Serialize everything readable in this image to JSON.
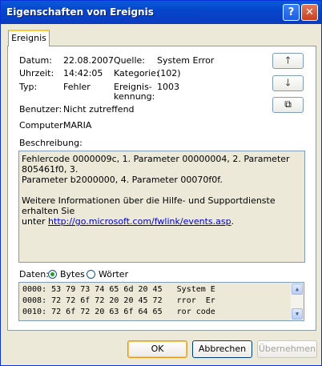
{
  "window": {
    "title": "Eigenschaften von Ereignis",
    "help_glyph": "?",
    "close_glyph": "✕"
  },
  "tab": {
    "label": "Ereignis"
  },
  "fields": {
    "datum_label": "Datum:",
    "datum_value": "22.08.2007",
    "uhrzeit_label": "Uhrzeit:",
    "uhrzeit_value": "14:42:05",
    "typ_label": "Typ:",
    "typ_value": "Fehler",
    "benutzer_label": "Benutzer:",
    "benutzer_value": "Nicht zutreffend",
    "computer_label": "Computer:",
    "computer_value": "MARIA",
    "quelle_label": "Quelle:",
    "quelle_value": "System Error",
    "kategorie_label": "Kategorie:",
    "kategorie_value": "(102)",
    "kennung_label_1": "Ereignis-",
    "kennung_label_2": "kennung:",
    "kennung_value": "1003"
  },
  "side_buttons": {
    "up": "🡑",
    "down": "🡓",
    "copy": "⧉"
  },
  "description": {
    "label": "Beschreibung:",
    "line1": "Fehlercode 0000009c, 1. Parameter 00000004, 2. Parameter 805461f0, 3.",
    "line2": "Parameter b2000000, 4. Parameter 00070f0f.",
    "line3": "Weitere Informationen über die Hilfe- und Supportdienste erhalten Sie",
    "line4_prefix": "unter ",
    "link": "http://go.microsoft.com/fwlink/events.asp",
    "line4_suffix": "."
  },
  "data_section": {
    "label": "Daten:",
    "option_bytes": "Bytes",
    "option_words": "Wörter",
    "selected": "Bytes",
    "lines": [
      "0000: 53 79 73 74 65 6d 20 45   System E",
      "0008: 72 72 6f 72 20 20 45 72   rror  Er",
      "0010: 72 6f 72 20 63 6f 64 65   ror code"
    ]
  },
  "buttons": {
    "ok": "OK",
    "cancel": "Abbrechen",
    "apply": "Übernehmen"
  }
}
